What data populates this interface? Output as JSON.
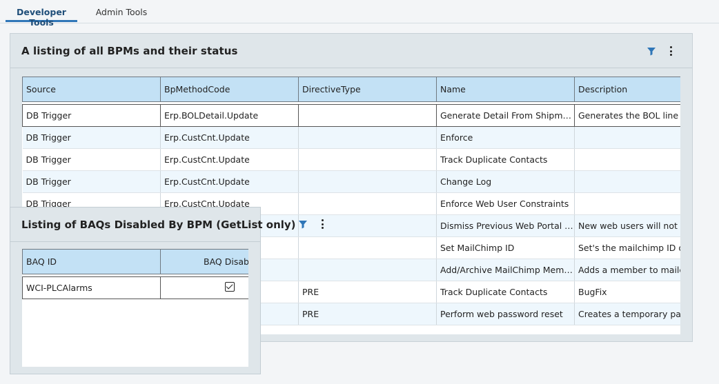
{
  "tabs": [
    {
      "label": "Developer Tools",
      "active": true
    },
    {
      "label": "Admin Tools",
      "active": false
    }
  ],
  "bpm_panel": {
    "title": "A listing of all BPMs and their status",
    "columns": [
      "Source",
      "BpMethodCode",
      "DirectiveType",
      "Name",
      "Description"
    ],
    "rows": [
      [
        "DB Trigger",
        "Erp.BOLDetail.Update",
        "",
        "Generate Detail From Shipment",
        "Generates the BOL line details"
      ],
      [
        "DB Trigger",
        "Erp.CustCnt.Update",
        "",
        "Enforce",
        ""
      ],
      [
        "DB Trigger",
        "Erp.CustCnt.Update",
        "",
        "Track Duplicate Contacts",
        ""
      ],
      [
        "DB Trigger",
        "Erp.CustCnt.Update",
        "",
        "Change Log",
        ""
      ],
      [
        "DB Trigger",
        "Erp.CustCnt.Update",
        "",
        "Enforce Web User Constraints",
        ""
      ],
      [
        "",
        "",
        "",
        "Dismiss Previous Web Portal …",
        "New web users will not need"
      ],
      [
        "",
        "",
        "",
        "Set MailChimp ID",
        "Set's the mailchimp ID of"
      ],
      [
        "",
        "",
        "",
        "Add/Archive MailChimp Member",
        "Adds a member to mailchimp"
      ],
      [
        "",
        "",
        "PRE",
        "Track Duplicate Contacts",
        "BugFix"
      ],
      [
        "",
        "",
        "PRE",
        "Perform web password reset",
        "Creates a temporary password"
      ]
    ]
  },
  "baq_panel": {
    "title": "Listing of BAQs Disabled By BPM (GetList only)",
    "columns": [
      "BAQ ID",
      "BAQ Disabled"
    ],
    "rows": [
      {
        "id": "WCI-PLCAlarms",
        "disabled": true
      }
    ]
  },
  "icons": {
    "filter": "filter-icon",
    "menu": "kebab-menu-icon"
  },
  "colors": {
    "accent": "#2f76b8",
    "header_bg": "#c3e1f5",
    "panel_bg": "#dfe6ea",
    "row_alt": "#eef7fd"
  }
}
